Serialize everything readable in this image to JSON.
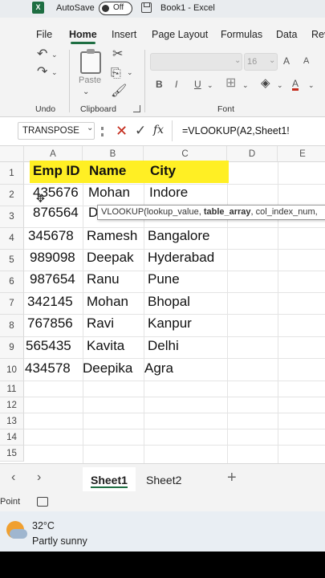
{
  "titlebar": {
    "app_icon": "X",
    "autosave_label": "AutoSave",
    "autosave_state": "Off",
    "document_title": "Book1 - Excel"
  },
  "ribbon_tabs": [
    "File",
    "Home",
    "Insert",
    "Page Layout",
    "Formulas",
    "Data",
    "Rev"
  ],
  "ribbon": {
    "undo_group": "Undo",
    "clipboard_group": "Clipboard",
    "font_group": "Font",
    "paste_label": "Paste",
    "font_name": "",
    "font_size": "16",
    "grow_font": "A",
    "shrink_font": "A",
    "bold": "B",
    "italic": "I",
    "underline": "U",
    "font_color_letter": "A"
  },
  "formula_bar": {
    "name_box": "TRANSPOSE",
    "fx": "fx",
    "formula": "=VLOOKUP(A2,Sheet1!"
  },
  "grid": {
    "columns": [
      "A",
      "B",
      "C",
      "D",
      "E"
    ],
    "row_numbers": [
      "1",
      "2",
      "3",
      "4",
      "5",
      "6",
      "7",
      "8",
      "9",
      "10",
      "11",
      "12",
      "13",
      "14",
      "15"
    ],
    "header_row": [
      "Emp ID",
      "Name",
      "City"
    ],
    "rows": [
      [
        "435676",
        "Mohan",
        "Indore"
      ],
      [
        "876564",
        "D",
        ""
      ],
      [
        "345678",
        "Ramesh",
        "Bangalore"
      ],
      [
        "989098",
        "Deepak",
        "Hyderabad"
      ],
      [
        "987654",
        "Ranu",
        "Pune"
      ],
      [
        "342145",
        "Mohan",
        "Bhopal"
      ],
      [
        "767856",
        "Ravi",
        "Kanpur"
      ],
      [
        "565435",
        "Kavita",
        "Delhi"
      ],
      [
        "434578",
        "Deepika",
        "Agra"
      ]
    ],
    "tooltip": {
      "fn": "VLOOKUP(",
      "arg1": "lookup_value, ",
      "arg2": "table_array",
      "arg3": ", col_index_num,"
    },
    "header_fill_color": "#ffef24"
  },
  "sheets": {
    "tabs": [
      "Sheet1",
      "Sheet2"
    ],
    "active": "Sheet1",
    "add_label": "+"
  },
  "statusbar": {
    "mode": "Point"
  },
  "taskbar": {
    "temperature": "32°C",
    "weather": "Partly sunny"
  },
  "colors": {
    "accent": "#1e6e42",
    "cancel": "#c42b1c"
  }
}
